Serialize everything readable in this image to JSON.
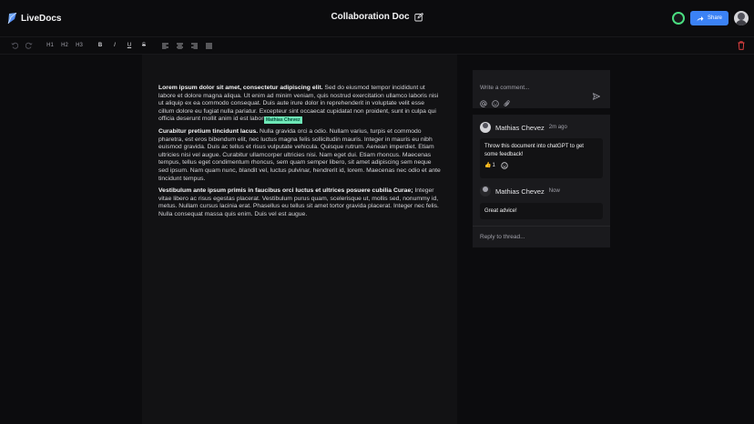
{
  "app": {
    "name": "LiveDocs"
  },
  "document": {
    "title": "Collaboration Doc"
  },
  "header": {
    "share_label": "Share"
  },
  "toolbar": {
    "h1": "H1",
    "h2": "H2",
    "h3": "H3",
    "bold": "B",
    "italic": "I",
    "underline": "U",
    "strike": "S"
  },
  "editor": {
    "paragraphs": [
      {
        "lead": "Lorem ipsum dolor sit amet, consectetur adipiscing elit.",
        "body": " Sed do eiusmod tempor incididunt ut labore et dolore magna aliqua. Ut enim ad minim veniam, quis nostrud exercitation ullamco laboris nisi ut aliquip ex ea commodo consequat. Duis aute irure dolor in reprehenderit in voluptate velit esse cillum dolore eu fugiat nulla pariatur. Excepteur sint occaecat cupidatat non proident, sunt in culpa qui officia deserunt mollit anim id est laborum."
      },
      {
        "lead": "Curabitur pretium tincidunt lacus.",
        "body": " Nulla gravida orci a odio. Nullam varius, turpis et commodo pharetra, est eros bibendum elit, nec luctus magna felis sollicitudin mauris. Integer in mauris eu nibh euismod gravida. Duis ac tellus et risus vulputate vehicula. Quisque rutrum. Aenean imperdiet. Etiam ultricies nisi vel augue. Curabitur ullamcorper ultricies nisi. Nam eget dui. Etiam rhoncus. Maecenas tempus, tellus eget condimentum rhoncus, sem quam semper libero, sit amet adipiscing sem neque sed ipsum. Nam quam nunc, blandit vel, luctus pulvinar, hendrerit id, lorem. Maecenas nec odio et ante tincidunt tempus."
      },
      {
        "lead": "Vestibulum ante ipsum primis in faucibus orci luctus et ultrices posuere cubilia Curae;",
        "body": " Integer vitae libero ac risus egestas placerat. Vestibulum purus quam, scelerisque ut, mollis sed, nonummy id, metus. Nullam cursus lacinia erat. Phasellus eu tellus sit amet tortor gravida placerat. Integer nec felis. Nulla consequat massa quis enim. Duis vel est augue."
      }
    ],
    "cursor_label": "Mathias Chevez"
  },
  "composer": {
    "placeholder": "Write a comment..."
  },
  "thread": {
    "comments": [
      {
        "author": "Mathias Chevez",
        "time": "2m ago",
        "text": "Throw this document into chatGPT to get some feedback!",
        "reaction_emoji": "👍",
        "reaction_count": "1"
      },
      {
        "author": "Mathias Chevez",
        "time": "Now",
        "text": "Great advice!"
      }
    ],
    "reply_placeholder": "Reply to thread..."
  },
  "colors": {
    "accent": "#3b82f6",
    "presence": "#4ade80",
    "cursor": "#6ee7b7"
  }
}
